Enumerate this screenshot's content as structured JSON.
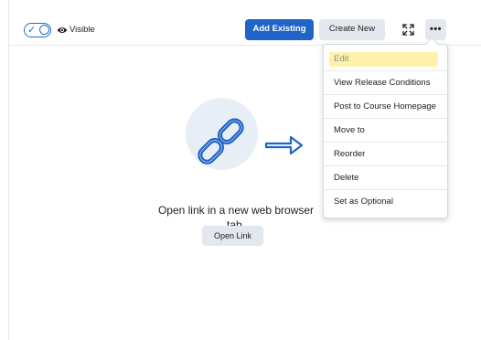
{
  "visibility": {
    "label": "Visible",
    "enabled": true
  },
  "toolbar": {
    "add_existing_label": "Add Existing",
    "create_new_label": "Create New",
    "more_label": "•••"
  },
  "menu": {
    "items": [
      {
        "label": "Edit",
        "highlighted": true
      },
      {
        "label": "View Release Conditions"
      },
      {
        "label": "Post to Course Homepage"
      },
      {
        "label": "Move to"
      },
      {
        "label": "Reorder"
      },
      {
        "label": "Delete"
      },
      {
        "label": "Set as Optional"
      }
    ]
  },
  "content": {
    "description": "Open link in a new web browser tab.",
    "open_link_label": "Open Link"
  },
  "colors": {
    "primary": "#1f64c6",
    "secondary_btn": "#e3e7ee",
    "highlight": "#fff2a8",
    "illustration_bg": "#e8eef5"
  }
}
